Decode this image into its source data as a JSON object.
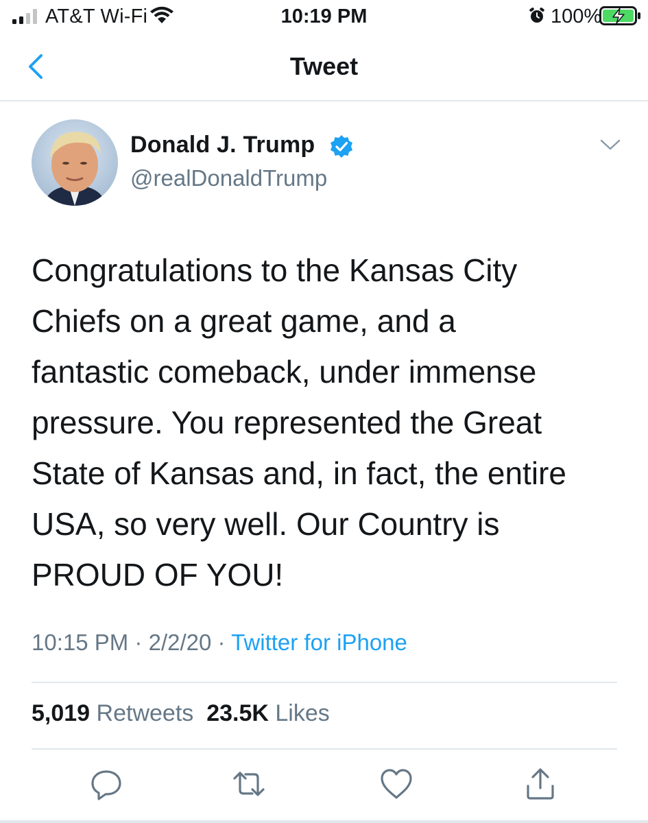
{
  "status_bar": {
    "carrier": "AT&T Wi-Fi",
    "time": "10:19 PM",
    "battery_percent": "100%",
    "signal_bars": 2,
    "icons": [
      "signal-icon",
      "wifi-icon",
      "alarm-icon",
      "battery-charging-icon"
    ]
  },
  "nav": {
    "title": "Tweet",
    "back_icon": "chevron-left-icon"
  },
  "tweet": {
    "author_name": "Donald J. Trump",
    "handle": "@realDonaldTrump",
    "verified": true,
    "text_lines": [
      "Congratulations to the Kansas City",
      "Chiefs on a great game, and a",
      "fantastic comeback, under immense",
      "pressure. You represented the Great",
      "State of Kansas and, in fact, the entire",
      "USA, so very well. Our Country is",
      "PROUD OF YOU!"
    ],
    "time": "10:15 PM",
    "separator": "·",
    "date": "2/2/20",
    "source": "Twitter for iPhone"
  },
  "stats": {
    "retweets_count": "5,019",
    "retweets_label": "Retweets",
    "likes_count": "23.5K",
    "likes_label": "Likes"
  },
  "actions": {
    "icons": [
      "reply-icon",
      "retweet-icon",
      "like-icon",
      "share-icon"
    ]
  },
  "colors": {
    "accent": "#1da1f2",
    "text": "#14171a",
    "secondary_text": "#657786",
    "divider": "#e1e8ed",
    "battery_green": "#4cd964"
  }
}
